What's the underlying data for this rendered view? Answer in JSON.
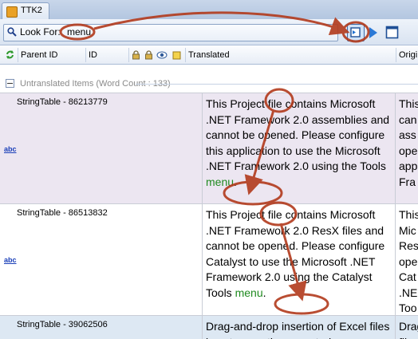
{
  "window": {
    "tab_title": "TTK2"
  },
  "search": {
    "label": "Look For:",
    "value": "menu"
  },
  "columns": [
    "Parent ID",
    "ID",
    "Translated",
    "Origi"
  ],
  "group": {
    "label": "Untranslated Items (Word Count : 133)"
  },
  "rows": [
    {
      "key": "StringTable - 86213779",
      "translated": [
        {
          "t": "This Project file contains Microsoft .NET Framework 2.0 assemblies and cannot be opened. Please configure this application to use the Microsoft .NET Framework 2.0 using the Tools "
        },
        {
          "t": "menu",
          "hl": true
        },
        {
          "t": "."
        }
      ],
      "original": [
        "This",
        "can",
        "ass",
        "ope",
        "app",
        "Fra"
      ],
      "badge": "abc"
    },
    {
      "key": "StringTable - 86513832",
      "translated": [
        {
          "t": "This Project file contains Microsoft .NET Framework 2.0 ResX files and cannot be opened. Please configure Catalyst to use the Microsoft .NET Framework 2.0 using the Catalyst Tools "
        },
        {
          "t": "menu",
          "hl": true
        },
        {
          "t": "."
        }
      ],
      "original": [
        "This",
        "Mic",
        "Res",
        "ope",
        "Cat",
        ".NE",
        "Too"
      ],
      "badge": "abc"
    },
    {
      "key": "StringTable - 39062506",
      "translated": [
        {
          "t": "Drag-and-drop insertion of Excel files is not currently supported."
        }
      ],
      "original": [
        "Drag",
        "file"
      ],
      "badge": ""
    }
  ],
  "colors": {
    "highlight": "#1f8a1f",
    "annotation": "#b23a1c",
    "row_selected": "#ece6f1",
    "row_plain": "#ffffff",
    "row_blue": "#dde8f3"
  }
}
